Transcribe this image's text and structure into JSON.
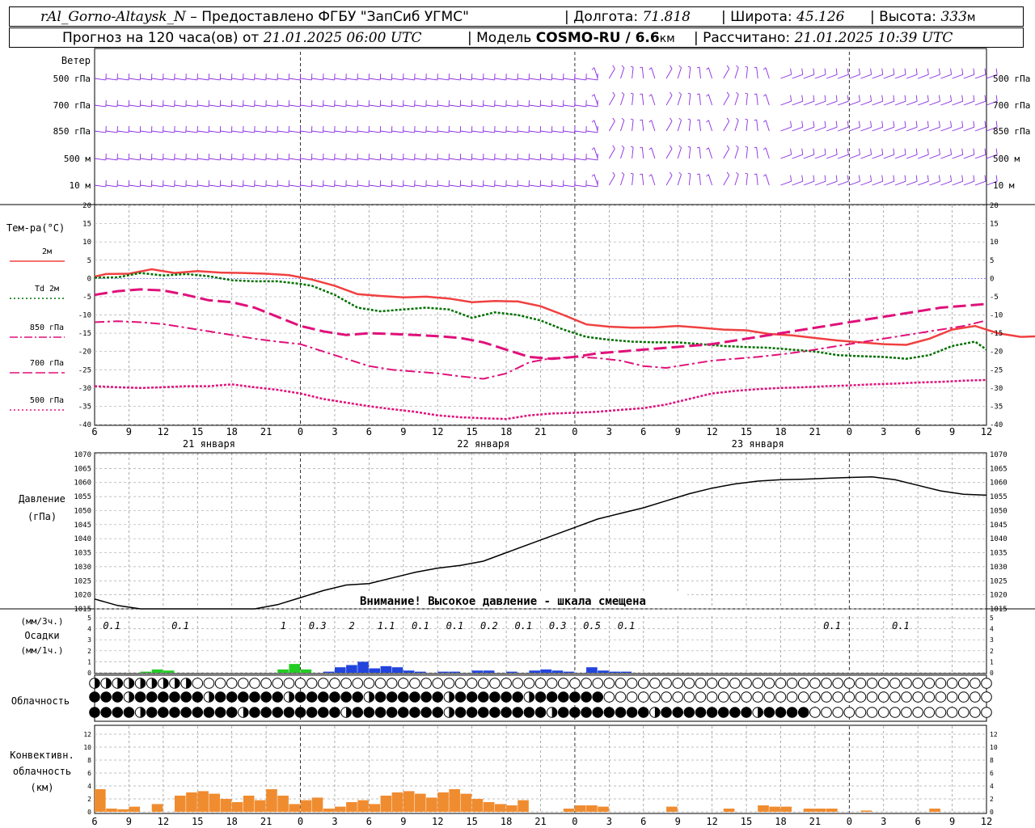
{
  "header": {
    "station": "rAl_Gorno-Altaysk_N",
    "provider": "Предоставлено ФГБУ \"ЗапСиб УГМС\"",
    "lon_label": "Долгота:",
    "lon_value": "71.818",
    "lat_label": "Широта:",
    "lat_value": "45.126",
    "alt_label": "Высота:",
    "alt_value": "333",
    "alt_unit": "м",
    "forecast_prefix": "Прогноз на 120 часа(ов) от",
    "forecast_time": "21.01.2025 06:00 UTC",
    "model_label": "Модель",
    "model_name": "COSMO-RU / 6.6",
    "model_unit": "км",
    "calc_label": "Рассчитано:",
    "calc_time": "21.01.2025 10:39 UTC"
  },
  "colors": {
    "t2m": "#f04040",
    "td2m": "#007000",
    "t850": "#e0107a",
    "t700": "#e0107a",
    "t500": "#e0107a",
    "wind": "#8a2be2",
    "precip_green": "#22cc22",
    "precip_blue": "#2244dd",
    "convective": "#f08c30",
    "pressure": "#000000",
    "zero_line": "#4444ff"
  },
  "wind_panel": {
    "title": "Ветер",
    "levels": [
      "500 гПа",
      "700 гПа",
      "850 гПа",
      "500 м",
      "10 м"
    ]
  },
  "temp_panel": {
    "title": "Тем-ра(°C)",
    "legend": [
      {
        "label": "2м",
        "style": "solid"
      },
      {
        "label": "Td 2м",
        "style": "dotted"
      },
      {
        "label": "850 гПа",
        "style": "dashdot"
      },
      {
        "label": "700 гПа",
        "style": "dashed"
      },
      {
        "label": "500 гПа",
        "style": "dotted"
      }
    ],
    "yticks": [
      "20",
      "15",
      "10",
      "5",
      "0",
      "-5",
      "-10",
      "-15",
      "-20",
      "-25",
      "-30",
      "-35",
      "-40"
    ],
    "dates": [
      "21 января",
      "22 января",
      "23 января"
    ]
  },
  "pressure_panel": {
    "title": "Давление",
    "unit": "(гПа)",
    "yticks": [
      "1070",
      "1065",
      "1060",
      "1055",
      "1050",
      "1045",
      "1040",
      "1035",
      "1030",
      "1025",
      "1020",
      "1015"
    ],
    "warning": "Внимание! Высокое давление - шкала смещена"
  },
  "precip_panel": {
    "unit_top": "(мм/3ч.)",
    "title": "Осадки",
    "unit_bottom": "(мм/1ч.)",
    "yticks": [
      "5",
      "4",
      "3",
      "2",
      "1",
      "0"
    ],
    "totals": [
      {
        "h": 1.5,
        "v": "0.1"
      },
      {
        "h": 7.5,
        "v": "0.1"
      },
      {
        "h": 16.5,
        "v": "1"
      },
      {
        "h": 19.5,
        "v": "0.3"
      },
      {
        "h": 22.5,
        "v": "2"
      },
      {
        "h": 25.5,
        "v": "1.1"
      },
      {
        "h": 28.5,
        "v": "0.1"
      },
      {
        "h": 31.5,
        "v": "0.1"
      },
      {
        "h": 34.5,
        "v": "0.2"
      },
      {
        "h": 37.5,
        "v": "0.1"
      },
      {
        "h": 40.5,
        "v": "0.3"
      },
      {
        "h": 43.5,
        "v": "0.5"
      },
      {
        "h": 46.5,
        "v": "0.1"
      },
      {
        "h": 64.5,
        "v": "0.1"
      },
      {
        "h": 70.5,
        "v": "0.1"
      }
    ]
  },
  "cloud_panel": {
    "title": "Облачность"
  },
  "conv_panel": {
    "title1": "Конвективн.",
    "title2": "облачность",
    "unit": "(км)",
    "yticks": [
      "12",
      "10",
      "8",
      "6",
      "4",
      "2",
      "0"
    ]
  },
  "x_ticks": [
    "6",
    "9",
    "12",
    "15",
    "18",
    "21",
    "0",
    "3",
    "6",
    "9",
    "12",
    "15",
    "18",
    "21",
    "0",
    "3",
    "6",
    "9",
    "12",
    "15",
    "18",
    "21",
    "0",
    "3",
    "6",
    "9",
    "12"
  ],
  "chart_data": [
    {
      "type": "line",
      "title": "Тем-ра(°C)",
      "x_unit": "hours from 21.01.2025 06:00 UTC",
      "ylim": [
        -40,
        20
      ],
      "series": [
        {
          "name": "2м",
          "x": [
            0,
            1,
            3,
            5,
            7,
            9,
            11,
            13,
            15,
            17,
            19,
            21,
            23,
            25,
            27,
            29,
            31,
            33,
            35,
            37,
            39,
            41,
            43,
            45,
            47,
            49,
            51,
            53,
            55,
            57,
            59,
            61,
            63,
            65,
            67,
            69,
            71,
            73,
            75,
            77,
            79,
            81,
            83,
            85,
            87,
            89,
            91,
            93,
            95,
            97,
            99,
            101,
            103,
            105,
            107,
            108
          ],
          "y": [
            0.5,
            1.2,
            1.3,
            2.5,
            1.5,
            2.0,
            1.6,
            1.5,
            1.3,
            0.9,
            -0.3,
            -2.0,
            -4.3,
            -4.8,
            -5.2,
            -5.0,
            -5.5,
            -6.5,
            -6.2,
            -6.3,
            -7.6,
            -10.0,
            -12.6,
            -13.2,
            -13.5,
            -13.4,
            -13.0,
            -13.5,
            -14.0,
            -14.2,
            -15.2,
            -15.6,
            -16.3,
            -17.0,
            -17.5,
            -18.0,
            -18.2,
            -16.5,
            -14.0,
            -13.0,
            -15.0,
            -16.0,
            -15.8,
            -16.0,
            -16.0,
            -16.2,
            -16.5,
            -16.5,
            -16.7,
            -16.9,
            -17.0,
            -17.0,
            -17.0,
            -17.0,
            -17.0,
            -17.0
          ]
        },
        {
          "name": "Td 2м",
          "x": [
            0,
            2,
            4,
            6,
            8,
            10,
            12,
            14,
            16,
            18,
            19,
            21,
            23,
            25,
            27,
            29,
            31,
            33,
            35,
            37,
            39,
            41,
            43,
            45,
            47,
            49,
            51,
            53,
            55,
            57,
            59,
            61,
            63,
            65,
            67,
            69,
            71,
            73,
            75,
            77,
            78
          ],
          "y": [
            0.2,
            0.3,
            1.5,
            0.8,
            1.2,
            0.6,
            -0.5,
            -0.8,
            -0.8,
            -1.5,
            -2.0,
            -4.5,
            -8.0,
            -9.0,
            -8.5,
            -8.0,
            -8.5,
            -10.8,
            -9.3,
            -10.0,
            -11.5,
            -14.0,
            -16.0,
            -16.8,
            -17.3,
            -17.5,
            -17.5,
            -18.0,
            -18.5,
            -18.8,
            -19.0,
            -19.5,
            -20.0,
            -21.0,
            -21.3,
            -21.5,
            -22.0,
            -21.0,
            -18.5,
            -17.3,
            -19.5
          ]
        },
        {
          "name": "850 гПа",
          "x": [
            0,
            2,
            4,
            6,
            8,
            10,
            12,
            14,
            16,
            18,
            20,
            22,
            24,
            26,
            28,
            30,
            32,
            34,
            36,
            38,
            40,
            42,
            44,
            46,
            48,
            50,
            52,
            54,
            56,
            58,
            60,
            62,
            64,
            66,
            68,
            70,
            72,
            74,
            76,
            78
          ],
          "y": [
            -12,
            -11.7,
            -12.0,
            -12.5,
            -13.5,
            -14.5,
            -15.5,
            -16.5,
            -17.3,
            -18.0,
            -20,
            -22,
            -24,
            -25,
            -25.5,
            -26,
            -26.8,
            -27.5,
            -26,
            -23,
            -21.8,
            -21.5,
            -21.8,
            -22.5,
            -24,
            -24.5,
            -23.5,
            -22.5,
            -22.0,
            -21.5,
            -20.8,
            -20.0,
            -19.0,
            -18.0,
            -17.0,
            -16.0,
            -15.0,
            -14.0,
            -13.0,
            -11.5
          ]
        },
        {
          "name": "700 гПа",
          "x": [
            0,
            2,
            4,
            6,
            8,
            10,
            12,
            14,
            16,
            18,
            20,
            22,
            24,
            26,
            28,
            30,
            32,
            34,
            36,
            38,
            40,
            42,
            44,
            46,
            48,
            50,
            52,
            54,
            56,
            58,
            60,
            62,
            64,
            66,
            68,
            70,
            72,
            74,
            76,
            78
          ],
          "y": [
            -4.5,
            -3.5,
            -3.0,
            -3.3,
            -4.5,
            -6.0,
            -6.5,
            -8.0,
            -10.5,
            -13.0,
            -14.5,
            -15.5,
            -15.0,
            -15.2,
            -15.5,
            -15.8,
            -16.3,
            -17.5,
            -19.5,
            -21.5,
            -22.0,
            -21.5,
            -20.5,
            -20.0,
            -19.5,
            -19.0,
            -18.5,
            -18.0,
            -17.0,
            -16.0,
            -15.0,
            -14.0,
            -13.0,
            -12.0,
            -11.0,
            -10.0,
            -9.0,
            -8.0,
            -7.5,
            -7.0
          ]
        },
        {
          "name": "500 гПа",
          "x": [
            0,
            2,
            4,
            6,
            8,
            10,
            12,
            14,
            16,
            18,
            20,
            22,
            24,
            26,
            28,
            30,
            32,
            34,
            36,
            38,
            40,
            42,
            44,
            46,
            48,
            50,
            52,
            54,
            56,
            58,
            60,
            62,
            64,
            66,
            68,
            70,
            72,
            74,
            76,
            78
          ],
          "y": [
            -29.5,
            -29.8,
            -30.0,
            -29.8,
            -29.5,
            -29.5,
            -29.0,
            -29.8,
            -30.5,
            -31.5,
            -33,
            -34,
            -35,
            -35.8,
            -36.5,
            -37.5,
            -38.0,
            -38.3,
            -38.5,
            -37.5,
            -37.0,
            -36.8,
            -36.5,
            -36.0,
            -35.5,
            -34.5,
            -33.0,
            -31.5,
            -30.8,
            -30.3,
            -30.0,
            -29.8,
            -29.5,
            -29.3,
            -29.0,
            -28.8,
            -28.5,
            -28.3,
            -28.0,
            -27.8
          ]
        }
      ]
    },
    {
      "type": "line",
      "title": "Давление",
      "x_unit": "hours from 21.01.2025 06:00 UTC",
      "ylim": [
        1015,
        1070
      ],
      "series": [
        {
          "name": "Давление",
          "x": [
            0,
            2,
            4,
            6,
            8,
            10,
            12,
            14,
            16,
            18,
            20,
            22,
            24,
            26,
            28,
            30,
            32,
            34,
            36,
            38,
            40,
            42,
            44,
            46,
            48,
            50,
            52,
            54,
            56,
            58,
            60,
            62,
            64,
            66,
            68,
            70,
            72,
            74,
            76,
            78
          ],
          "y": [
            1018.5,
            1016.2,
            1014.0,
            1012.5,
            1011.8,
            1012.0,
            1012.8,
            1014.5,
            1016.5,
            1019.0,
            1021.5,
            1023.5,
            1024.0,
            1026.0,
            1028.0,
            1029.5,
            1030.5,
            1032.0,
            1035.0,
            1038.0,
            1041.0,
            1044.0,
            1047.0,
            1049.0,
            1051.0,
            1053.5,
            1056.0,
            1058.0,
            1059.5,
            1060.5,
            1061.0,
            1061.2,
            1061.5,
            1061.8,
            1062.0,
            1061.0,
            1059.0,
            1057.0,
            1055.8,
            1055.5
          ]
        }
      ]
    },
    {
      "type": "bar",
      "title": "Осадки",
      "x_unit": "hours from 21.01.2025 06:00 UTC",
      "ylim": [
        0,
        5
      ],
      "series": [
        {
          "name": "1h precipitation",
          "x": [
            1,
            2,
            3,
            4,
            5,
            6,
            7,
            8,
            9,
            10,
            11,
            12,
            13,
            14,
            15,
            16,
            17,
            18,
            19,
            20,
            21,
            22,
            23,
            24,
            25,
            26,
            27,
            28,
            29,
            30,
            31,
            32,
            33,
            34,
            35,
            36,
            37,
            38,
            39,
            40,
            41,
            42,
            43,
            44,
            45,
            46,
            47
          ],
          "y": [
            0,
            0,
            0,
            0,
            0.1,
            0.3,
            0.2,
            0,
            0,
            0,
            0,
            0,
            0,
            0,
            0,
            0,
            0.3,
            0.8,
            0.3,
            0,
            0.1,
            0.5,
            0.7,
            1.0,
            0.4,
            0.6,
            0.5,
            0.2,
            0.1,
            0,
            0.1,
            0.1,
            0,
            0.2,
            0.2,
            0,
            0.1,
            0,
            0.2,
            0.3,
            0.2,
            0.1,
            0,
            0.5,
            0.2,
            0.1,
            0.1
          ]
        }
      ]
    },
    {
      "type": "bar",
      "title": "Конвективн. облачность",
      "x_unit": "hours from 21.01.2025 06:00 UTC",
      "ylim": [
        0,
        13
      ],
      "series": [
        {
          "name": "Convective top (km)",
          "x": [
            0,
            1,
            2,
            3,
            4,
            5,
            6,
            7,
            8,
            9,
            10,
            11,
            12,
            13,
            14,
            15,
            16,
            17,
            18,
            19,
            20,
            21,
            22,
            23,
            24,
            25,
            26,
            27,
            28,
            29,
            30,
            31,
            32,
            33,
            34,
            35,
            36,
            37,
            38,
            39,
            40,
            41,
            42,
            43,
            44,
            45,
            46,
            47,
            48,
            49,
            50,
            51,
            52,
            53,
            54,
            55,
            56,
            57,
            58,
            59,
            60,
            61,
            62,
            63,
            64,
            65,
            66,
            67,
            68,
            69,
            70,
            71,
            72,
            73,
            74,
            75,
            76,
            77,
            78
          ],
          "y": [
            3.5,
            0.5,
            0.4,
            0.8,
            0,
            1.2,
            0,
            2.5,
            3.0,
            3.2,
            2.8,
            2.0,
            1.5,
            2.5,
            1.8,
            3.5,
            2.5,
            1.2,
            1.8,
            2.2,
            0.5,
            0.8,
            1.5,
            1.8,
            1.2,
            2.5,
            3.0,
            3.2,
            2.8,
            2.2,
            3.0,
            3.5,
            2.8,
            2.0,
            1.5,
            1.2,
            1.0,
            1.8,
            0,
            0,
            0,
            0.5,
            1.0,
            1.0,
            0.8,
            0,
            0,
            0,
            0,
            0,
            0.8,
            0,
            0,
            0,
            0,
            0.5,
            0,
            0,
            1.0,
            0.8,
            0.8,
            0,
            0.5,
            0.5,
            0.5,
            0,
            0,
            0.2,
            0,
            0,
            0,
            0,
            0,
            0.5,
            0,
            0,
            0,
            0,
            0
          ]
        }
      ]
    }
  ]
}
